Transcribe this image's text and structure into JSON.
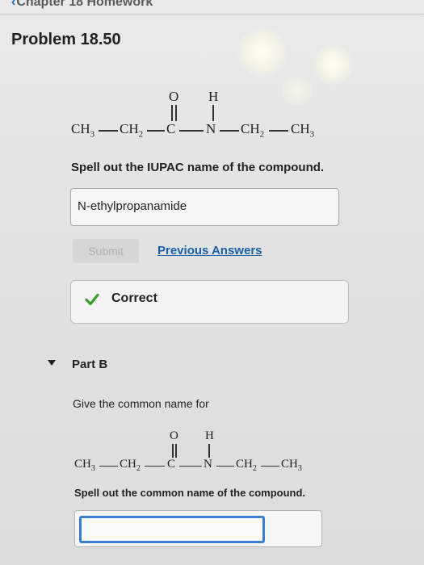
{
  "header": {
    "back_label": "Chapter 18 Homework"
  },
  "problem": {
    "title": "Problem 18.50"
  },
  "part_a": {
    "structure": {
      "o": "O",
      "h": "H",
      "ch3_left": "CH",
      "ch3_left_sub": "3",
      "ch2_left": "CH",
      "ch2_left_sub": "2",
      "c": "C",
      "n": "N",
      "ch2_right": "CH",
      "ch2_right_sub": "2",
      "ch3_right": "CH",
      "ch3_right_sub": "3"
    },
    "prompt": "Spell out the IUPAC name of the compound.",
    "answer_value": "N-ethylpropanamide",
    "submit_label": "Submit",
    "previous_answers_label": "Previous Answers",
    "feedback": "Correct"
  },
  "part_b": {
    "title": "Part B",
    "description": "Give the common name for",
    "structure": {
      "o": "O",
      "h": "H",
      "ch3_left": "CH",
      "ch3_left_sub": "3",
      "ch2_left": "CH",
      "ch2_left_sub": "2",
      "c": "C",
      "n": "N",
      "ch2_right": "CH",
      "ch2_right_sub": "2",
      "ch3_right": "CH",
      "ch3_right_sub": "3"
    },
    "prompt": "Spell out the common name of the compound.",
    "answer_value": ""
  },
  "colors": {
    "link": "#1a5ea8",
    "correct_check": "#3e9b2f",
    "input_focus": "#3a7ed0"
  },
  "icons": {
    "back": "chevron-left-icon",
    "correct": "checkmark-icon",
    "part_toggle": "caret-down-icon"
  }
}
